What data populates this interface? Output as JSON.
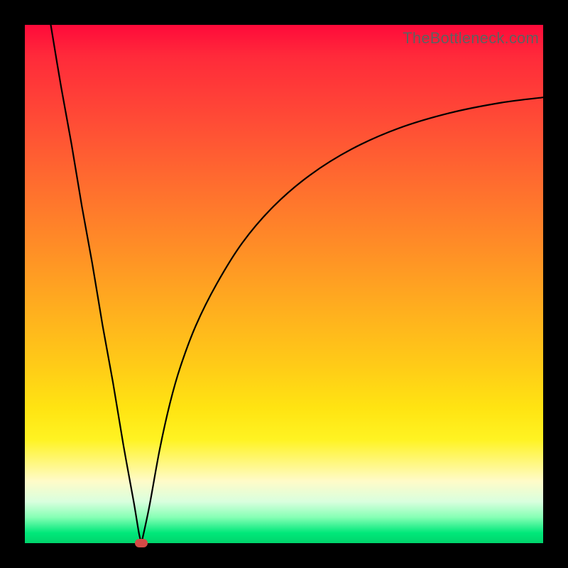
{
  "attribution": "TheBottleneck.com",
  "colors": {
    "bg_frame": "#000000",
    "gradient_top": "#ff0a3a",
    "gradient_bottom": "#00d46c",
    "curve": "#000000",
    "marker": "#d44a46"
  },
  "chart_data": {
    "type": "line",
    "title": "",
    "xlabel": "",
    "ylabel": "",
    "xlim": [
      0,
      100
    ],
    "ylim": [
      0,
      100
    ],
    "grid": false,
    "legend": false,
    "series": [
      {
        "name": "left-branch",
        "x": [
          5,
          7,
          9,
          11,
          13,
          15,
          17,
          19,
          21,
          22,
          22.5
        ],
        "values": [
          100,
          88,
          77,
          65,
          54,
          42,
          31,
          19,
          8,
          2,
          0
        ]
      },
      {
        "name": "right-branch",
        "x": [
          22.5,
          24,
          26,
          28,
          30,
          33,
          37,
          42,
          48,
          55,
          63,
          72,
          82,
          92,
          100
        ],
        "values": [
          0,
          7,
          18,
          27,
          34,
          42,
          50,
          58,
          65,
          71,
          76,
          80,
          83,
          85,
          86
        ]
      }
    ],
    "annotations": [
      {
        "type": "marker",
        "x": 22.5,
        "y": 0,
        "name": "minimum-point"
      }
    ]
  }
}
